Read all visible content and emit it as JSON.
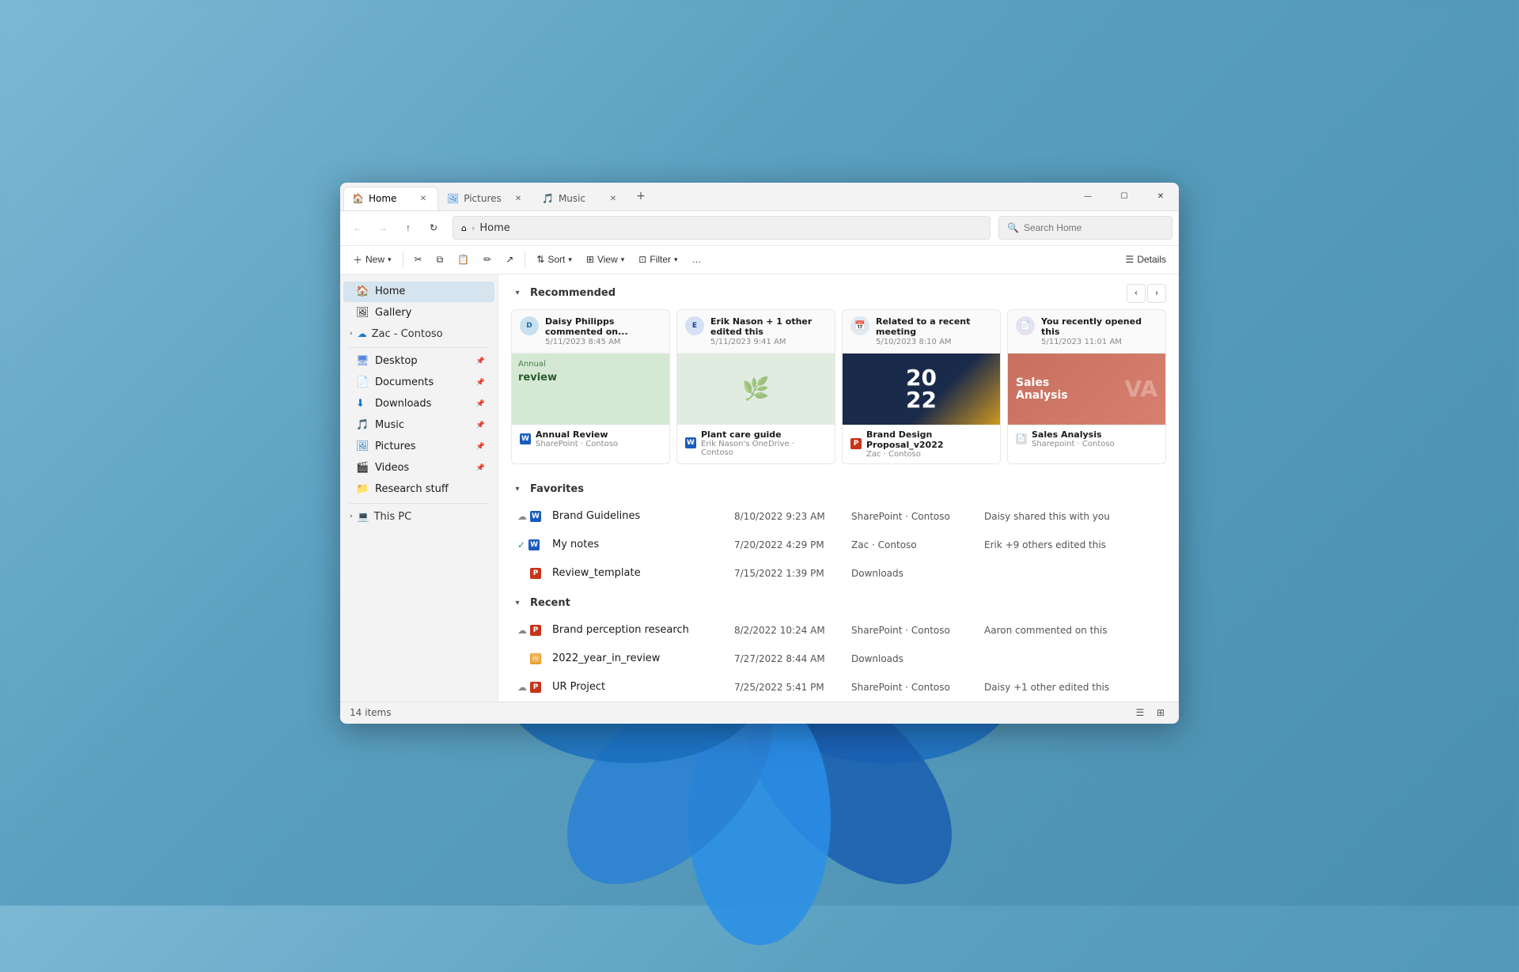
{
  "window": {
    "title": "Home",
    "controls": {
      "minimize": "—",
      "maximize": "☐",
      "close": "✕"
    }
  },
  "tabs": [
    {
      "id": "home",
      "label": "Home",
      "icon": "home",
      "active": true
    },
    {
      "id": "pictures",
      "label": "Pictures",
      "icon": "pictures",
      "active": false
    },
    {
      "id": "music",
      "label": "Music",
      "icon": "music",
      "active": false
    }
  ],
  "toolbar": {
    "back": "←",
    "forward": "→",
    "up": "↑",
    "refresh": "↻",
    "home": "⌂",
    "breadcrumb_sep": ">",
    "address": "Home",
    "search_placeholder": "Search Home"
  },
  "commandbar": {
    "new_label": "New",
    "cut_label": "✂",
    "copy_label": "⧉",
    "paste_label": "📋",
    "rename_label": "✏",
    "share_label": "↗",
    "sort_label": "Sort",
    "view_label": "View",
    "filter_label": "Filter",
    "more_label": "…",
    "details_label": "Details"
  },
  "sidebar": {
    "items": [
      {
        "id": "home",
        "label": "Home",
        "icon": "🏠",
        "active": true
      },
      {
        "id": "gallery",
        "label": "Gallery",
        "icon": "🖼",
        "active": false
      }
    ],
    "zac_group": {
      "label": "Zac - Contoso",
      "expanded": false,
      "items": []
    },
    "quick_access": [
      {
        "id": "desktop",
        "label": "Desktop",
        "icon": "🖥",
        "pinned": true
      },
      {
        "id": "documents",
        "label": "Documents",
        "icon": "📄",
        "pinned": true
      },
      {
        "id": "downloads",
        "label": "Downloads",
        "icon": "⬇",
        "pinned": true
      },
      {
        "id": "music",
        "label": "Music",
        "icon": "🎵",
        "pinned": true
      },
      {
        "id": "pictures",
        "label": "Pictures",
        "icon": "🖼",
        "pinned": true
      },
      {
        "id": "videos",
        "label": "Videos",
        "icon": "🎬",
        "pinned": true
      },
      {
        "id": "research",
        "label": "Research stuff",
        "icon": "📁",
        "pinned": false
      }
    ],
    "this_pc": {
      "label": "This PC",
      "expanded": false
    }
  },
  "recommended": {
    "section_label": "Recommended",
    "cards": [
      {
        "id": "annual",
        "activity": "Daisy Philipps commented on...",
        "date": "5/11/2023 8:45 AM",
        "filename": "Annual Review",
        "location": "SharePoint · Contoso",
        "thumb_type": "annual",
        "avatar_initials": "D"
      },
      {
        "id": "plant",
        "activity": "Erik Nason + 1 other edited this",
        "date": "5/11/2023 9:41 AM",
        "filename": "Plant care guide",
        "location": "Erik Nason's OneDrive · Contoso",
        "thumb_type": "plant",
        "avatar_initials": "E"
      },
      {
        "id": "brand",
        "activity": "Related to a recent meeting",
        "date": "5/10/2023 8:10 AM",
        "filename": "Brand Design Proposal_v2022",
        "location": "Zac · Contoso",
        "thumb_type": "brand",
        "avatar_initials": "📅"
      },
      {
        "id": "sales",
        "activity": "You recently opened this",
        "date": "5/11/2023 11:01 AM",
        "filename": "Sales Analysis",
        "location": "Sharepoint · Contoso",
        "thumb_type": "sales",
        "avatar_initials": "📄"
      }
    ]
  },
  "favorites": {
    "section_label": "Favorites",
    "items": [
      {
        "name": "Brand Guidelines",
        "date": "8/10/2022 9:23 AM",
        "location": "SharePoint · Contoso",
        "activity": "Daisy shared this with you",
        "cloud": true,
        "type": "word"
      },
      {
        "name": "My notes",
        "date": "7/20/2022 4:29 PM",
        "location": "Zac · Contoso",
        "activity": "Erik +9 others edited this",
        "cloud_sync": true,
        "type": "word"
      },
      {
        "name": "Review_template",
        "date": "7/15/2022 1:39 PM",
        "location": "Downloads",
        "activity": "",
        "type": "ppt"
      }
    ]
  },
  "recent": {
    "section_label": "Recent",
    "items": [
      {
        "name": "Brand perception research",
        "date": "8/2/2022 10:24 AM",
        "location": "SharePoint · Contoso",
        "activity": "Aaron commented on this",
        "cloud": true,
        "type": "ppt"
      },
      {
        "name": "2022_year_in_review",
        "date": "7/27/2022 8:44 AM",
        "location": "Downloads",
        "activity": "",
        "type": "img"
      },
      {
        "name": "UR Project",
        "date": "7/25/2022 5:41 PM",
        "location": "SharePoint · Contoso",
        "activity": "Daisy +1 other edited this",
        "cloud": true,
        "type": "ppt"
      }
    ]
  },
  "statusbar": {
    "items_count": "14",
    "items_label": "items"
  }
}
